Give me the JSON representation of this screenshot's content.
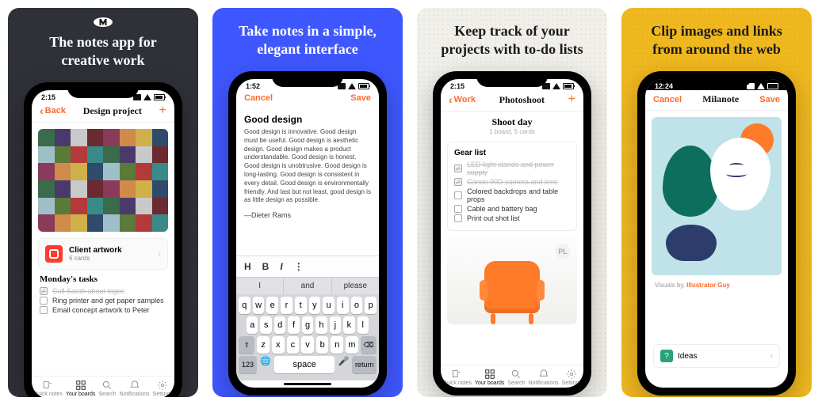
{
  "cards": [
    {
      "headline": "The notes app for creative work",
      "status_time": "2:15",
      "nav": {
        "back": "Back",
        "title": "Design project",
        "add": "+"
      },
      "list_card": {
        "title": "Client artwork",
        "meta": "6 cards"
      },
      "section": "Monday's tasks",
      "todos": [
        {
          "label": "Call Sarah about logos",
          "done": true
        },
        {
          "label": "Ring printer and get paper samples",
          "done": false
        },
        {
          "label": "Email concept artwork to Peter",
          "done": false
        }
      ],
      "tabs": [
        "Quick notes",
        "Your boards",
        "Search",
        "Notifications",
        "Settings"
      ],
      "active_tab": 1
    },
    {
      "headline": "Take notes in a simple, elegant interface",
      "status_time": "1:52",
      "nav": {
        "cancel": "Cancel",
        "save": "Save"
      },
      "note_title": "Good design",
      "note_body": "Good design is innovative. Good design must be useful. Good design is aesthetic design. Good design makes a product understandable. Good design is honest. Good design is unobtrusive. Good design is long-lasting. Good design is consistent in every detail. Good design is environmentally friendly. And last but not least, good design is as little design as possible.",
      "note_sign": "—Dieter Rams",
      "format_bar": [
        "H",
        "B",
        "I",
        "⋮"
      ],
      "suggestions": [
        "I",
        "and",
        "please"
      ],
      "keyboard": {
        "row1": [
          "q",
          "w",
          "e",
          "r",
          "t",
          "y",
          "u",
          "i",
          "o",
          "p"
        ],
        "row2": [
          "a",
          "s",
          "d",
          "f",
          "g",
          "h",
          "j",
          "k",
          "l"
        ],
        "row3_shift": "⇧",
        "row3": [
          "z",
          "x",
          "c",
          "v",
          "b",
          "n",
          "m"
        ],
        "row3_del": "⌫",
        "bottom": {
          "num": "123",
          "space": "space",
          "return": "return"
        }
      }
    },
    {
      "headline": "Keep track of your projects with to-do lists",
      "status_time": "2:15",
      "nav": {
        "back": "Work",
        "title": "Photoshoot",
        "add": "+"
      },
      "subhead": {
        "title": "Shoot day",
        "meta": "1 board, 5 cards"
      },
      "panel_title": "Gear list",
      "todos": [
        {
          "label": "LED light stands and power supply",
          "done": true
        },
        {
          "label": "Canon 90D camera and lens",
          "done": true
        },
        {
          "label": "Colored backdrops and table props",
          "done": false
        },
        {
          "label": "Cable and battery bag",
          "done": false
        },
        {
          "label": "Print out shot list",
          "done": false
        }
      ],
      "fab": "PL",
      "tabs": [
        "Quick notes",
        "Your boards",
        "Search",
        "Notifications",
        "Settings"
      ],
      "active_tab": 1
    },
    {
      "headline": "Clip images and links from around the web",
      "status_time": "12:24",
      "nav": {
        "cancel": "Cancel",
        "title": "Milanote",
        "save": "Save"
      },
      "caption_prefix": "Visuals by, ",
      "caption_link": "Illustrator Guy",
      "chip": {
        "icon": "?",
        "label": "Ideas"
      }
    }
  ],
  "mosaic_palette": [
    "#6b2a2f",
    "#b23a3a",
    "#d08a4a",
    "#3a6b4a",
    "#2f4a6b",
    "#c9c9c9",
    "#5a7a3a",
    "#8a3a5a",
    "#3a8a8a",
    "#d0b04a",
    "#4a3a6b",
    "#a0c0c9"
  ]
}
